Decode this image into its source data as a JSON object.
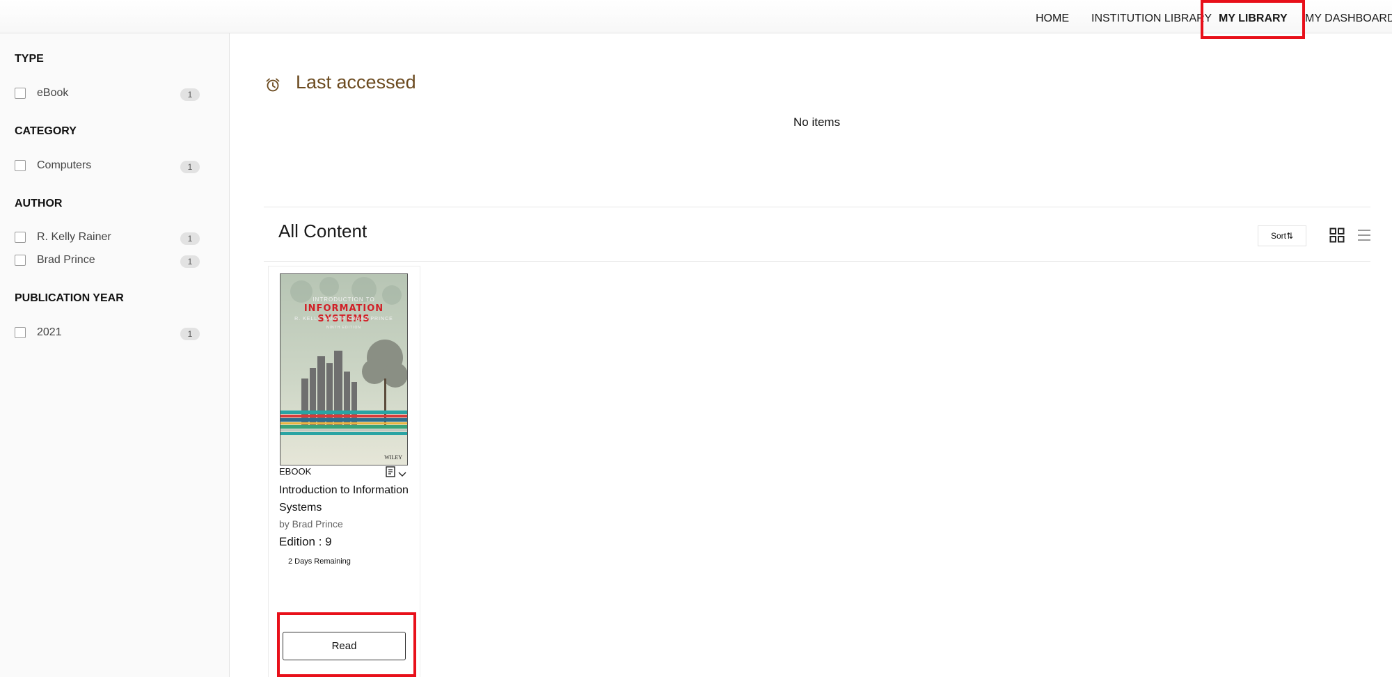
{
  "nav": {
    "items": [
      {
        "label": "HOME",
        "active": false
      },
      {
        "label": "INSTITUTION LIBRARY",
        "active": false
      },
      {
        "label": "MY LIBRARY",
        "active": true
      },
      {
        "label": "MY DASHBOARD",
        "active": false
      }
    ]
  },
  "filters": {
    "type": {
      "heading": "TYPE",
      "options": [
        {
          "label": "eBook",
          "count": "1"
        }
      ]
    },
    "category": {
      "heading": "CATEGORY",
      "options": [
        {
          "label": "Computers",
          "count": "1"
        }
      ]
    },
    "author": {
      "heading": "AUTHOR",
      "options": [
        {
          "label": "R. Kelly Rainer",
          "count": "1"
        },
        {
          "label": "Brad Prince",
          "count": "1"
        }
      ]
    },
    "year": {
      "heading": "PUBLICATION YEAR",
      "options": [
        {
          "label": "2021",
          "count": "1"
        }
      ]
    }
  },
  "last_accessed": {
    "title": "Last accessed",
    "empty_text": "No items",
    "icon": "alarm-clock-icon"
  },
  "all_content": {
    "title": "All Content",
    "sort_label": "Sort",
    "grid_icon": "grid-view-icon",
    "list_icon": "list-view-icon"
  },
  "book": {
    "cover": {
      "line1": "INTRODUCTION TO",
      "line2": "INFORMATION SYSTEMS",
      "line3": "R. KELLY RAINER   •   BRAD PRINCE",
      "line4": "NINTH EDITION",
      "publisher": "WILEY"
    },
    "type": "EBOOK",
    "title": "Introduction to Information Systems",
    "author": "by Brad Prince",
    "edition": "Edition : 9",
    "remaining": "2 Days Remaining",
    "read_label": "Read"
  },
  "colors": {
    "highlight": "#e8101a",
    "accent_brown": "#6b4a1f",
    "cover_red": "#d11f26"
  }
}
